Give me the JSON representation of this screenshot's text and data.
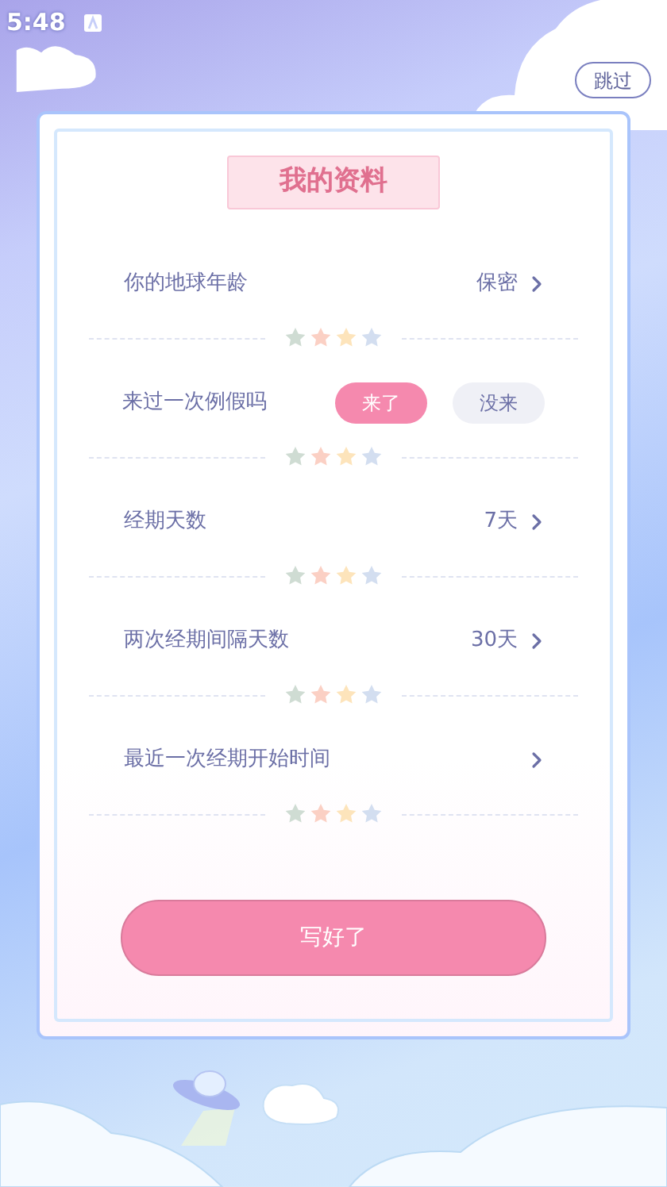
{
  "status_bar": {
    "time": "5:48"
  },
  "skip_button": {
    "label": "跳过"
  },
  "card": {
    "title": "我的资料",
    "rows": [
      {
        "kind": "select",
        "label": "你的地球年龄",
        "value": "保密"
      },
      {
        "kind": "choice",
        "label": "来过一次例假吗",
        "options": [
          {
            "label": "来了",
            "selected": true
          },
          {
            "label": "没来",
            "selected": false
          }
        ]
      },
      {
        "kind": "select",
        "label": "经期天数",
        "value": "7天"
      },
      {
        "kind": "select",
        "label": "两次经期间隔天数",
        "value": "30天"
      },
      {
        "kind": "select",
        "label": "最近一次经期开始时间"
      }
    ],
    "submit_button": {
      "label": "写好了"
    }
  }
}
